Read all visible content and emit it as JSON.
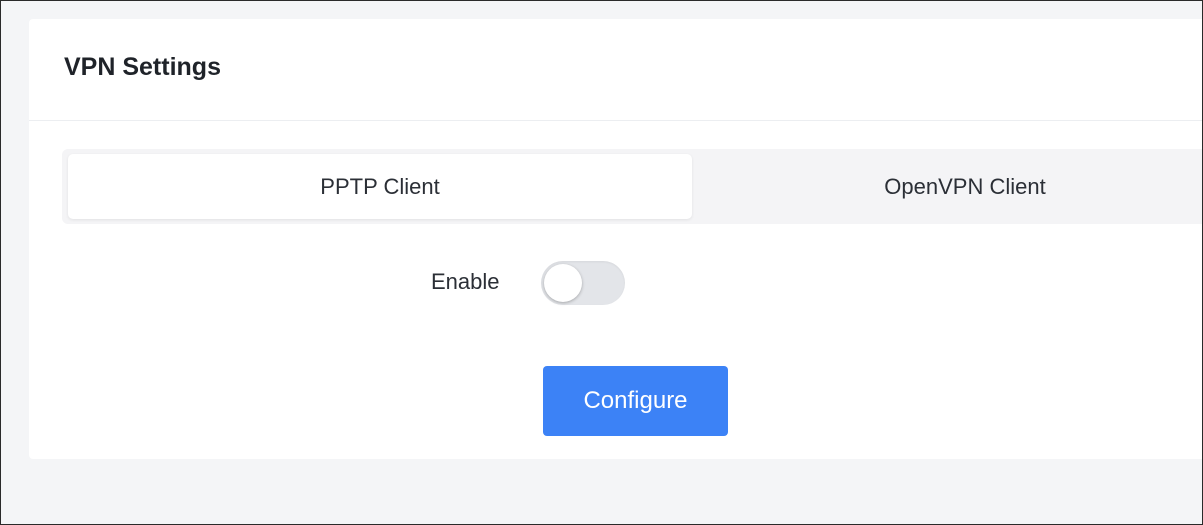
{
  "card": {
    "title": "VPN Settings"
  },
  "tabs": [
    {
      "label": "PPTP Client",
      "active": true
    },
    {
      "label": "OpenVPN Client",
      "active": false
    }
  ],
  "enable": {
    "label": "Enable",
    "checked": false
  },
  "actions": {
    "configure_label": "Configure"
  },
  "colors": {
    "primary": "#3c82f6",
    "background": "#f4f5f7",
    "toggle_off": "#e3e5e9"
  }
}
